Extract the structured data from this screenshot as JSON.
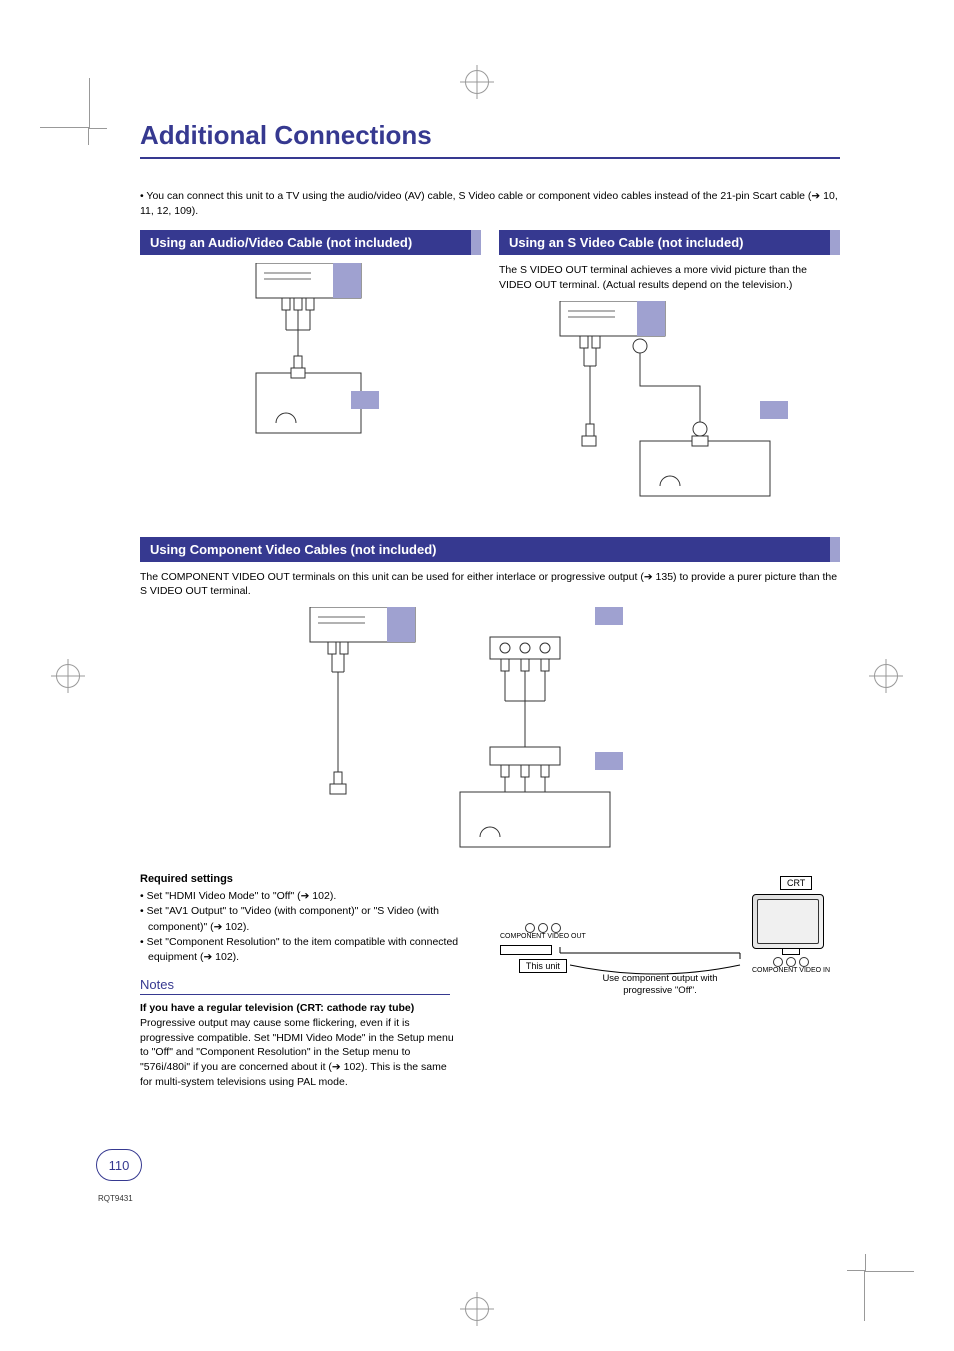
{
  "title": "Additional Connections",
  "intro": "• You can connect this unit to a TV using the audio/video (AV) cable, S Video cable or component video cables instead of the 21-pin Scart cable (➔ 10, 11, 12, 109).",
  "sectionA": {
    "header": "Using an Audio/Video Cable (not included)"
  },
  "sectionB": {
    "header": "Using an S Video Cable (not included)",
    "text": "The S VIDEO OUT terminal achieves a more vivid picture than the VIDEO OUT terminal. (Actual results depend on the television.)"
  },
  "sectionC": {
    "header": "Using Component Video Cables (not included)",
    "text": "The COMPONENT VIDEO OUT terminals on this unit can be used for either interlace or progressive output (➔ 135) to provide a purer picture than the S VIDEO OUT terminal."
  },
  "required": {
    "head": "Required settings",
    "b1": "• Set \"HDMI Video Mode\" to \"Off\" (➔ 102).",
    "b2": "• Set \"AV1 Output\" to \"Video (with component)\" or \"S Video (with component)\" (➔ 102).",
    "b3": "• Set \"Component Resolution\" to the item compatible with connected equipment (➔ 102)."
  },
  "notes": {
    "head": "Notes",
    "bold": "If you have a regular television (CRT: cathode ray tube)",
    "body": "Progressive output may cause some flickering, even if it is progressive compatible. Set \"HDMI Video Mode\" in the Setup menu to \"Off\" and \"Component Resolution\" in the Setup menu to \"576i/480i\" if you are concerned about it (➔ 102). This is the same for multi-system televisions using PAL mode."
  },
  "crt": {
    "label": "CRT",
    "thisunit": "This unit",
    "compout": "COMPONENT VIDEO OUT",
    "compin": "COMPONENT VIDEO IN",
    "bracket": "Use component output with progressive \"Off\"."
  },
  "footer": {
    "page": "110",
    "code": "RQT9431"
  }
}
